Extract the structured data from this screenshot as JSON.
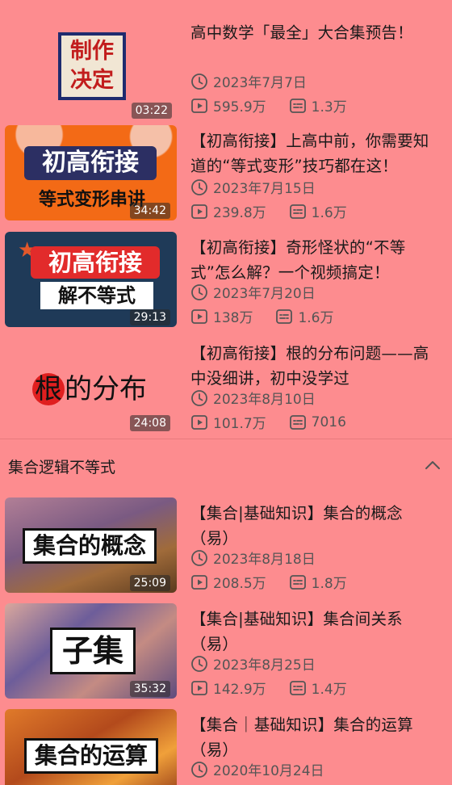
{
  "videos_top": [
    {
      "title": "高中数学「最全」大合集预告！",
      "date": "2023年7月7日",
      "views": "595.9万",
      "comments": "1.3万",
      "duration": "03:22",
      "thumb_text": [
        "制作",
        "决定"
      ]
    },
    {
      "title": "【初高衔接】上高中前，你需要知道的“等式变形”技巧都在这！",
      "date": "2023年7月15日",
      "views": "239.8万",
      "comments": "1.6万",
      "duration": "34:42",
      "thumb_text": [
        "初高衔接",
        "等式变形串讲"
      ]
    },
    {
      "title": "【初高衔接】奇形怪状的“不等式”怎么解？一个视频搞定！",
      "date": "2023年7月20日",
      "views": "138万",
      "comments": "1.6万",
      "duration": "29:13",
      "thumb_text": [
        "初高衔接",
        "解不等式"
      ]
    },
    {
      "title": "【初高衔接】根的分布问题——高中没细讲，初中没学过",
      "date": "2023年8月10日",
      "views": "101.7万",
      "comments": "7016",
      "duration": "24:08",
      "thumb_text": [
        "根",
        "的分布"
      ]
    }
  ],
  "section": {
    "title": "集合逻辑不等式"
  },
  "videos_section": [
    {
      "title": "【集合|基础知识】集合的概念（易）",
      "date": "2023年8月18日",
      "views": "208.5万",
      "comments": "1.8万",
      "duration": "25:09",
      "thumb_text": "集合的概念"
    },
    {
      "title": "【集合|基础知识】集合间关系（易）",
      "date": "2023年8月25日",
      "views": "142.9万",
      "comments": "1.4万",
      "duration": "35:32",
      "thumb_text": "子集"
    },
    {
      "title": "【集合｜基础知识】集合的运算（易）",
      "date": "2020年10月24日",
      "views": "",
      "comments": "",
      "duration": "",
      "thumb_text": "集合的运算"
    }
  ],
  "colors": {
    "background": "#fd8c8f",
    "divider": "#e77b7e"
  },
  "icons": {
    "date": "clock-icon",
    "views": "play-icon",
    "comments": "danmaku-icon",
    "collapse": "chevron-up-icon"
  }
}
